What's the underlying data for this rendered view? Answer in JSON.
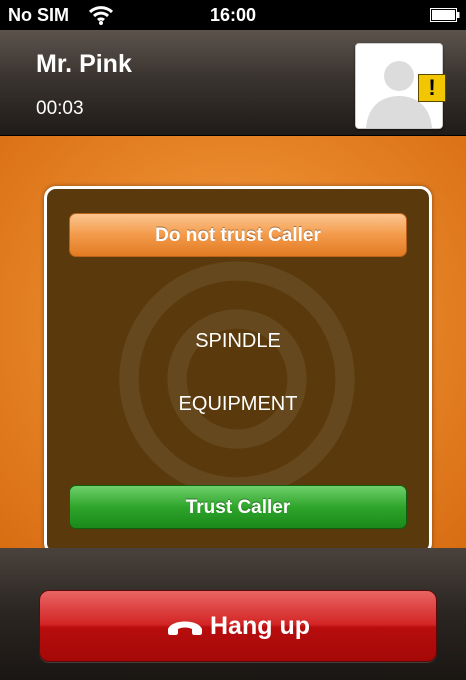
{
  "status_bar": {
    "carrier": "No SIM",
    "time": "16:00",
    "icons": [
      "wifi-icon",
      "battery-icon"
    ]
  },
  "call": {
    "caller_name": "Mr. Pink",
    "duration": "00:03",
    "avatar_icon": "person-silhouette-icon",
    "warning_badge": "!"
  },
  "trust_dialog": {
    "distrust_button": "Do not trust Caller",
    "line1": "SPINDLE",
    "line2": "EQUIPMENT",
    "trust_button": "Trust Caller"
  },
  "hangup": {
    "label": "Hang up",
    "icon": "phone-handset-icon"
  },
  "colors": {
    "orange_background": "#e98a2d",
    "dialog_background": "#5a3a0c",
    "distrust_button": "#f39a4a",
    "trust_button": "#2fa52b",
    "hangup_button": "#d32424",
    "warning_badge": "#f2c600"
  }
}
